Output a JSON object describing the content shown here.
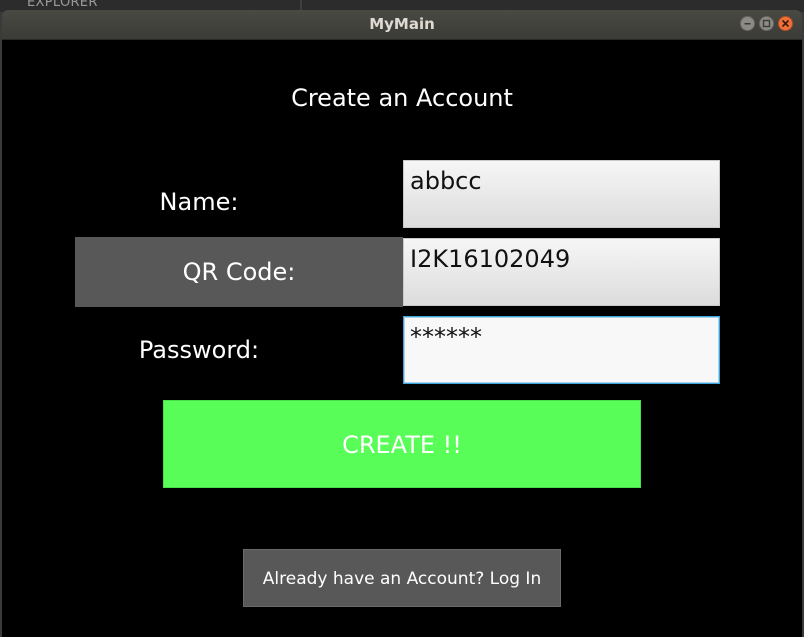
{
  "background": {
    "explorer_label": "EXPLORER"
  },
  "window": {
    "title": "MyMain",
    "controls": {
      "minimize_icon": "minimize-icon",
      "maximize_icon": "maximize-icon",
      "close_icon": "close-icon"
    }
  },
  "form": {
    "heading": "Create an Account",
    "name_label": "Name:",
    "name_value": "abbcc",
    "qr_label": "QR Code:",
    "qr_value": "I2K16102049",
    "password_label": "Password:",
    "password_value": "******",
    "create_label": "CREATE !!",
    "login_label": "Already have an Account? Log In"
  },
  "colors": {
    "window_bg": "#000000",
    "create_button": "#58fd58",
    "secondary_button": "#585858",
    "focus_border": "#3ea3d8",
    "close_button": "#f0703a"
  }
}
